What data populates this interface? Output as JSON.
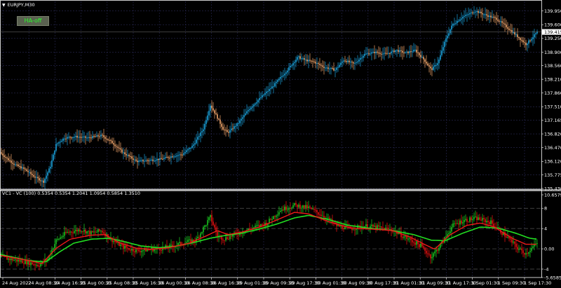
{
  "window": {
    "symbol": "EURJPY,M30",
    "menu_icon": "triangle-down-icon"
  },
  "button": {
    "label": "HA-off"
  },
  "subwindow": {
    "header": "VC1 - VC (100) 0.5354 0.5354 1.2041 1.0954 0.5854 1.3510"
  },
  "colors": {
    "bull": "#1aa2dc",
    "bear": "#f0a46a",
    "up_bar": "#19c11f",
    "down_bar": "#e01010",
    "fast_line": "#ee1a1a",
    "slow_line": "#22dd22",
    "grid": "#2a2a55",
    "current_price_bg": "#ffffff"
  },
  "chart_data": [
    {
      "type": "candlestick",
      "title": "EURJPY,M30",
      "price_axis_ticks": [
        139.95,
        139.6,
        139.25,
        138.9,
        138.56,
        138.21,
        137.86,
        137.51,
        137.165,
        136.82,
        136.47,
        136.12,
        135.775,
        135.43
      ],
      "price_axis_labels": [
        "139.950",
        "139.600",
        "139.250",
        "138.900",
        "138.560",
        "138.210",
        "137.860",
        "137.510",
        "137.165",
        "136.820",
        "136.470",
        "136.120",
        "135.775",
        "135.430"
      ],
      "current_price": "139.415",
      "ylim": [
        135.43,
        140.05
      ],
      "time_labels": [
        "24 Aug 2022",
        "24 Aug 08:30",
        "24 Aug 16:30",
        "25 Aug 00:30",
        "25 Aug 08:30",
        "25 Aug 16:30",
        "26 Aug 00:30",
        "26 Aug 08:30",
        "26 Aug 16:30",
        "29 Aug 01:30",
        "29 Aug 09:30",
        "29 Aug 17:30",
        "30 Aug 01:30",
        "30 Aug 09:30",
        "30 Aug 17:30",
        "31 Aug 01:30",
        "31 Aug 09:30",
        "31 Aug 17:30",
        "1 Sep 01:30",
        "1 Sep 09:30",
        "1 Sep 17:30"
      ],
      "close_anchors": [
        [
          0,
          136.35
        ],
        [
          8,
          136.22
        ],
        [
          20,
          136.05
        ],
        [
          35,
          135.92
        ],
        [
          50,
          135.72
        ],
        [
          62,
          135.6
        ],
        [
          72,
          136.0
        ],
        [
          80,
          136.55
        ],
        [
          92,
          136.72
        ],
        [
          108,
          136.75
        ],
        [
          125,
          136.72
        ],
        [
          145,
          136.78
        ],
        [
          160,
          136.6
        ],
        [
          175,
          136.35
        ],
        [
          195,
          136.12
        ],
        [
          212,
          136.15
        ],
        [
          230,
          136.18
        ],
        [
          245,
          136.25
        ],
        [
          260,
          136.3
        ],
        [
          275,
          136.52
        ],
        [
          290,
          136.95
        ],
        [
          300,
          137.55
        ],
        [
          308,
          137.3
        ],
        [
          318,
          136.95
        ],
        [
          325,
          136.85
        ],
        [
          340,
          137.1
        ],
        [
          355,
          137.45
        ],
        [
          372,
          137.75
        ],
        [
          390,
          138.05
        ],
        [
          410,
          138.45
        ],
        [
          425,
          138.78
        ],
        [
          435,
          138.7
        ],
        [
          448,
          138.65
        ],
        [
          462,
          138.52
        ],
        [
          478,
          138.45
        ],
        [
          490,
          138.7
        ],
        [
          505,
          138.6
        ],
        [
          520,
          138.85
        ],
        [
          535,
          138.9
        ],
        [
          550,
          138.85
        ],
        [
          565,
          138.95
        ],
        [
          578,
          138.88
        ],
        [
          592,
          138.95
        ],
        [
          605,
          138.7
        ],
        [
          615,
          138.45
        ],
        [
          625,
          138.65
        ],
        [
          635,
          139.2
        ],
        [
          645,
          139.6
        ],
        [
          660,
          139.8
        ],
        [
          678,
          139.95
        ],
        [
          692,
          139.85
        ],
        [
          708,
          139.75
        ],
        [
          722,
          139.55
        ],
        [
          738,
          139.3
        ],
        [
          750,
          139.1
        ],
        [
          758,
          139.25
        ],
        [
          766,
          139.41
        ]
      ]
    },
    {
      "type": "bar",
      "title": "VC1 - VC (100) 0.5354 0.5354 1.2041 1.0954 0.5854 1.3510",
      "axis_labels": [
        "10.6579",
        "8",
        "4",
        "0.00",
        "-4",
        "-5.6585"
      ],
      "ylim": [
        -5.6585,
        10.6579
      ],
      "value_anchors": [
        [
          0,
          -1.6
        ],
        [
          20,
          -2.2
        ],
        [
          40,
          -2.7
        ],
        [
          55,
          -3.2
        ],
        [
          68,
          -2.0
        ],
        [
          80,
          1.6
        ],
        [
          95,
          3.2
        ],
        [
          115,
          3.8
        ],
        [
          130,
          3.1
        ],
        [
          145,
          3.6
        ],
        [
          155,
          2.2
        ],
        [
          175,
          0.4
        ],
        [
          195,
          -0.4
        ],
        [
          215,
          -0.1
        ],
        [
          240,
          0.3
        ],
        [
          260,
          1.1
        ],
        [
          280,
          1.8
        ],
        [
          300,
          6.3
        ],
        [
          310,
          2.6
        ],
        [
          320,
          2.0
        ],
        [
          340,
          3.1
        ],
        [
          360,
          4.1
        ],
        [
          380,
          5.0
        ],
        [
          400,
          7.7
        ],
        [
          420,
          8.6
        ],
        [
          440,
          8.1
        ],
        [
          460,
          6.6
        ],
        [
          480,
          4.6
        ],
        [
          500,
          4.0
        ],
        [
          520,
          4.5
        ],
        [
          540,
          4.2
        ],
        [
          560,
          3.7
        ],
        [
          580,
          2.1
        ],
        [
          600,
          0.6
        ],
        [
          615,
          -1.6
        ],
        [
          630,
          1.1
        ],
        [
          645,
          4.5
        ],
        [
          660,
          5.6
        ],
        [
          680,
          6.0
        ],
        [
          700,
          5.2
        ],
        [
          720,
          2.7
        ],
        [
          740,
          -0.1
        ],
        [
          750,
          -0.9
        ],
        [
          766,
          1.1
        ]
      ],
      "fast_line_anchors": [
        [
          0,
          -1.3
        ],
        [
          40,
          -2.3
        ],
        [
          60,
          -2.9
        ],
        [
          80,
          0.1
        ],
        [
          100,
          1.9
        ],
        [
          130,
          2.7
        ],
        [
          150,
          2.8
        ],
        [
          170,
          1.2
        ],
        [
          195,
          0.1
        ],
        [
          215,
          -0.1
        ],
        [
          240,
          0.2
        ],
        [
          270,
          1.1
        ],
        [
          295,
          2.6
        ],
        [
          310,
          3.6
        ],
        [
          325,
          2.8
        ],
        [
          345,
          3.3
        ],
        [
          370,
          4.3
        ],
        [
          395,
          5.7
        ],
        [
          420,
          7.2
        ],
        [
          440,
          6.9
        ],
        [
          470,
          5.3
        ],
        [
          500,
          4.1
        ],
        [
          530,
          3.9
        ],
        [
          560,
          3.6
        ],
        [
          585,
          2.3
        ],
        [
          605,
          0.9
        ],
        [
          620,
          -0.1
        ],
        [
          640,
          2.6
        ],
        [
          665,
          4.6
        ],
        [
          685,
          5.1
        ],
        [
          705,
          4.3
        ],
        [
          730,
          2.1
        ],
        [
          750,
          0.9
        ],
        [
          766,
          0.9
        ]
      ],
      "slow_line_anchors": [
        [
          0,
          -1.1
        ],
        [
          40,
          -2.3
        ],
        [
          65,
          -2.6
        ],
        [
          85,
          -0.6
        ],
        [
          105,
          1.1
        ],
        [
          130,
          1.9
        ],
        [
          155,
          2.1
        ],
        [
          175,
          1.5
        ],
        [
          200,
          0.6
        ],
        [
          225,
          0.2
        ],
        [
          250,
          0.5
        ],
        [
          275,
          1.2
        ],
        [
          300,
          2.1
        ],
        [
          320,
          2.6
        ],
        [
          345,
          3.1
        ],
        [
          370,
          3.9
        ],
        [
          395,
          4.9
        ],
        [
          420,
          6.1
        ],
        [
          440,
          6.6
        ],
        [
          465,
          5.9
        ],
        [
          495,
          4.7
        ],
        [
          525,
          4.1
        ],
        [
          560,
          3.6
        ],
        [
          590,
          2.8
        ],
        [
          615,
          1.7
        ],
        [
          635,
          1.6
        ],
        [
          660,
          3.1
        ],
        [
          685,
          4.3
        ],
        [
          710,
          4.1
        ],
        [
          735,
          3.1
        ],
        [
          755,
          2.1
        ],
        [
          766,
          1.9
        ]
      ]
    }
  ]
}
